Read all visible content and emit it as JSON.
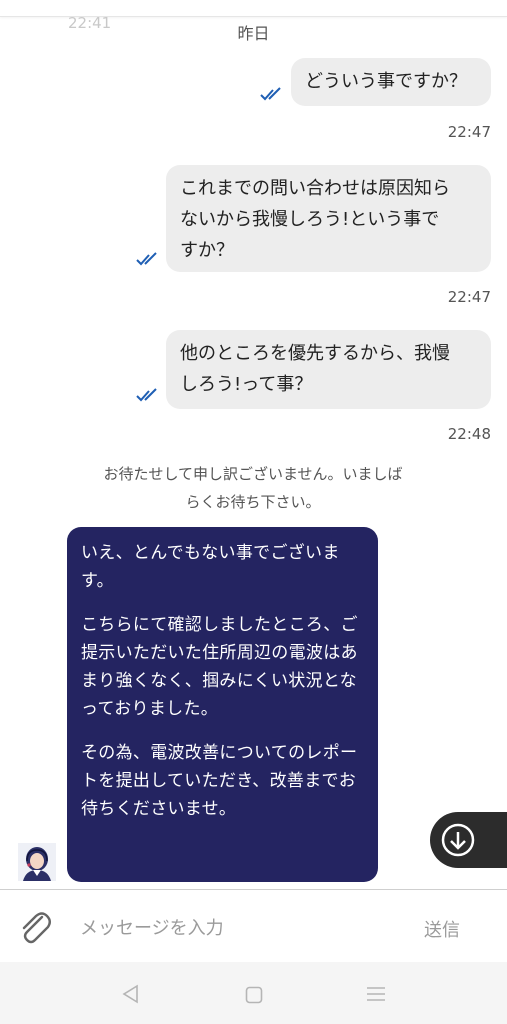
{
  "header": {
    "ghost_time": "22:41",
    "date_label": "昨日"
  },
  "messages_out": [
    {
      "text": "どういう事ですか？",
      "time": "22:47"
    },
    {
      "line1": "これまでの問い合わせは原因知ら",
      "line2": "ないから我慢しろう!という事で",
      "line3": "すか？",
      "time": "22:47"
    },
    {
      "line1": "他のところを優先するから、我慢",
      "line2": "しろう!って事？",
      "time": "22:48"
    }
  ],
  "system_message": {
    "line1": "お待たせして申し訳ございません。いましば",
    "line2": "らくお待ち下さい。"
  },
  "message_in": {
    "para1": "いえ、とんでもない事でございます。",
    "para2": "こちらにて確認しましたところ、ご提示いただいた住所周辺の電波はあまり強くなく、掴みにくい状況となっておりました。",
    "para3": "その為、電波改善についてのレポートを提出していただき、改善までお待ちくださいませ。"
  },
  "composer": {
    "placeholder": "メッセージを入力",
    "send_label": "送信"
  },
  "colors": {
    "agent_bubble": "#242461",
    "user_bubble": "#ededed",
    "read_check": "#1f5fb4"
  },
  "icons": [
    "double-check-icon",
    "scroll-down-icon",
    "paperclip-icon",
    "back-icon",
    "home-icon",
    "menu-icon",
    "agent-avatar"
  ]
}
